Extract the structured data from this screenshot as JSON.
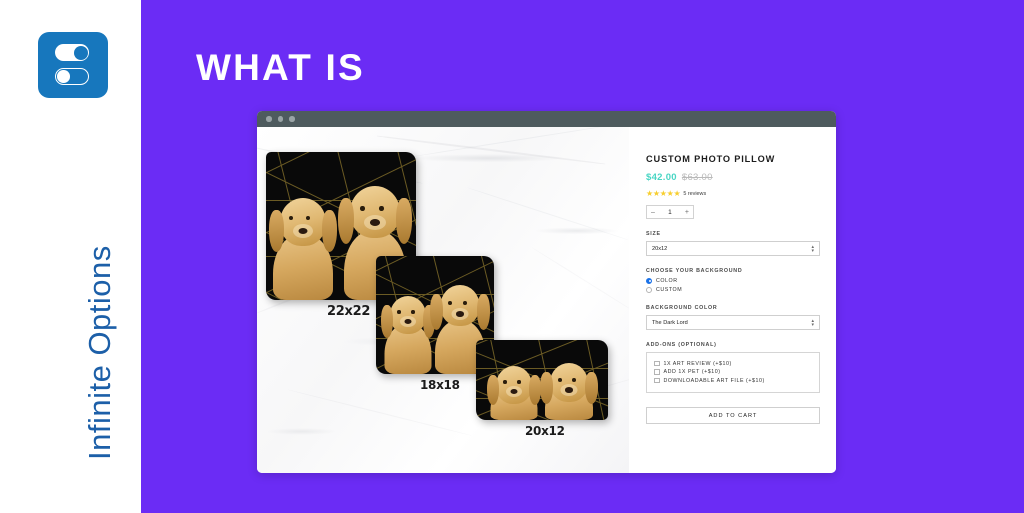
{
  "brand": {
    "name": "Infinite Options",
    "logo_color": "#1777BD",
    "text_color": "#1C5FA8"
  },
  "stage": {
    "headline": "WHAT IS",
    "background_color": "#6B2CF5"
  },
  "browser": {
    "chrome_color": "#4E5B5E",
    "dots": [
      "dot",
      "dot",
      "dot"
    ]
  },
  "gallery": {
    "pillows": [
      {
        "size_label": "22x22"
      },
      {
        "size_label": "18x18"
      },
      {
        "size_label": "20x12"
      }
    ]
  },
  "product": {
    "title": "CUSTOM PHOTO PILLOW",
    "price_sale": "$42.00",
    "price_compare": "$63.00",
    "price_sale_color": "#49D6C4",
    "stars": "★★★★★",
    "review_count": "5 reviews",
    "quantity": {
      "minus": "–",
      "value": "1",
      "plus": "+"
    },
    "size": {
      "label": "SIZE",
      "value": "20x12"
    },
    "background_choice": {
      "label": "CHOOSE YOUR BACKGROUND",
      "options": [
        {
          "label": "COLOR",
          "selected": true
        },
        {
          "label": "CUSTOM",
          "selected": false
        }
      ]
    },
    "background_color": {
      "label": "BACKGROUND COLOR",
      "value": "The Dark Lord"
    },
    "addons": {
      "label": "ADD-ONS (OPTIONAL)",
      "items": [
        {
          "label": "1X ART REVIEW (+$10)",
          "checked": false
        },
        {
          "label": "ADD 1X PET (+$10)",
          "checked": false
        },
        {
          "label": "DOWNLOADABLE ART FILE (+$10)",
          "checked": false
        }
      ]
    },
    "add_to_cart_label": "ADD TO CART"
  }
}
